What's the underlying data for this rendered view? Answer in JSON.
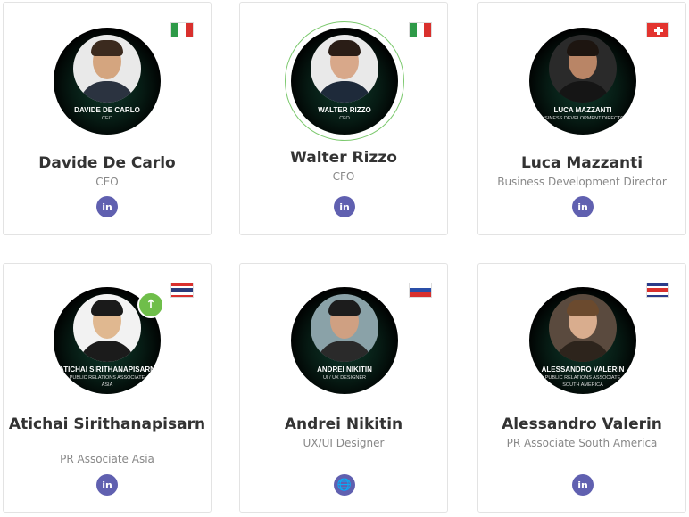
{
  "team": [
    {
      "name": "Davide De Carlo",
      "role": "CEO",
      "badge_name": "DAVIDE DE CARLO",
      "badge_role": "CEO",
      "flag": "Italy",
      "social": "linkedin-icon",
      "social_label": "in"
    },
    {
      "name": "Walter Rizzo",
      "role": "CFO",
      "badge_name": "WALTER RIZZO",
      "badge_role": "CFO",
      "flag": "Italy",
      "social": "linkedin-icon",
      "social_label": "in"
    },
    {
      "name": "Luca Mazzanti",
      "role": "Business Development Director",
      "badge_name": "LUCA MAZZANTI",
      "badge_role": "BUSINESS DEVELOPMENT DIRECTOR",
      "flag": "Switzerland",
      "social": "linkedin-icon",
      "social_label": "in"
    },
    {
      "name": "Atichai Sirithanapisarn",
      "role": "PR Associate Asia",
      "badge_name": "ATICHAI SIRITHANAPISARN",
      "badge_role": "PUBLIC RELATIONS ASSOCIATE",
      "badge_role2": "ASIA",
      "flag": "Thailand",
      "social": "linkedin-icon",
      "social_label": "in"
    },
    {
      "name": "Andrei Nikitin",
      "role": "UX/UI Designer",
      "badge_name": "ANDREI NIKITIN",
      "badge_role": "UI / UX DESIGNER",
      "flag": "Russia",
      "social": "globe-icon",
      "social_label": "🌐"
    },
    {
      "name": "Alessandro Valerin",
      "role": "PR Associate South America",
      "badge_name": "ALESSANDRO VALERIN",
      "badge_role": "PUBLIC RELATIONS ASSOCIATE",
      "badge_role2": "SOUTH AMERICA",
      "flag": "Costa Rica",
      "social": "linkedin-icon",
      "social_label": "in"
    }
  ],
  "colors": {
    "avatar_bg": "#061a13",
    "social_bg": "#6060b0",
    "badge_green": "#6fbe4a"
  },
  "scroll_up_icon": "arrow-up-icon"
}
